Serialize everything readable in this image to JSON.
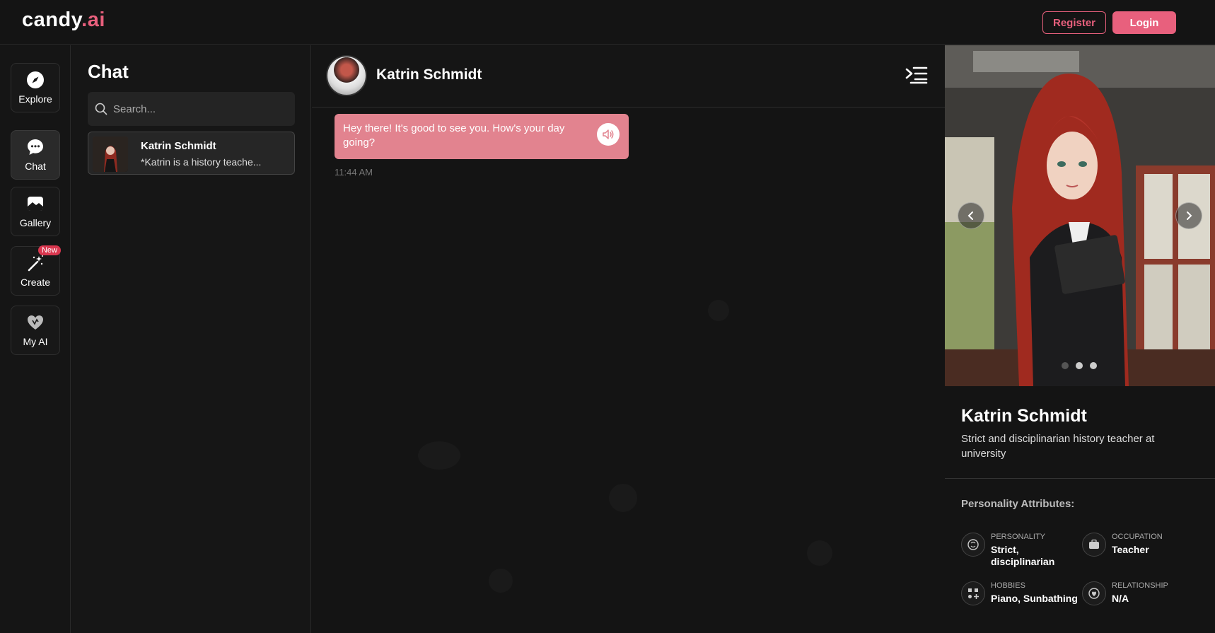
{
  "brand": {
    "logo_main": "candy",
    "logo_accent": ".ai",
    "accent_color": "#e8607d"
  },
  "header": {
    "register_label": "Register",
    "login_label": "Login"
  },
  "nav": {
    "items": [
      {
        "label": "Explore",
        "icon": "compass-icon"
      },
      {
        "label": "Chat",
        "icon": "chat-bubble-icon"
      },
      {
        "label": "Gallery",
        "icon": "image-icon"
      },
      {
        "label": "Create",
        "icon": "magic-wand-icon",
        "badge": "New"
      },
      {
        "label": "My AI",
        "icon": "heart-icon"
      }
    ]
  },
  "chat_list": {
    "title": "Chat",
    "search_placeholder": "Search...",
    "items": [
      {
        "name": "Katrin Schmidt",
        "preview": "*Katrin is a history teache..."
      }
    ]
  },
  "conversation": {
    "name": "Katrin Schmidt",
    "messages": [
      {
        "text": "Hey there! It's good to see you. How's your day going?",
        "time": "11:44 AM"
      }
    ]
  },
  "profile": {
    "name": "Katrin Schmidt",
    "description": "Strict and disciplinarian history teacher at university",
    "attributes_title": "Personality Attributes:",
    "attributes": [
      {
        "key": "PERSONALITY",
        "value": "Strict, disciplinarian",
        "icon": "brain-icon"
      },
      {
        "key": "OCCUPATION",
        "value": "Teacher",
        "icon": "briefcase-icon"
      },
      {
        "key": "HOBBIES",
        "value": "Piano, Sunbathing",
        "icon": "hobbies-icon"
      },
      {
        "key": "RELATIONSHIP",
        "value": "N/A",
        "icon": "relationship-icon"
      }
    ]
  }
}
